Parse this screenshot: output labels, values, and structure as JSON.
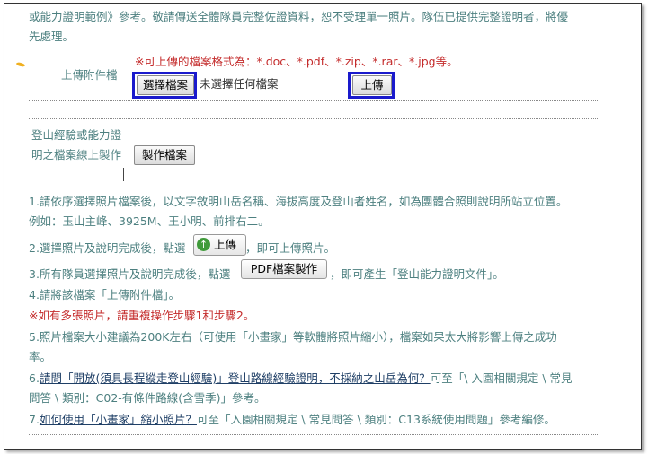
{
  "top": {
    "line1": "或能力證明範例》參考。敬請傳送全體隊員完整佐證資料，恕不受理單一照片。隊伍已提供完整證明者，將優",
    "line2": "先處理。"
  },
  "upload": {
    "label": "上傳附件檔",
    "formats_note": "※可上傳的檔案格式為：*.doc、*.pdf、*.zip、*.rar、*.jpg等。",
    "choose_button": "選擇檔案",
    "no_file": "未選擇任何檔案",
    "upload_button": "上傳"
  },
  "online": {
    "label_line1": "登山經驗或能力證",
    "label_line2": "明之檔案線上製作",
    "make_button": "製作檔案"
  },
  "steps": {
    "s1_line1": "1.請依序選擇照片檔案後，以文字敘明山岳名稱、海拔高度及登山者姓名，如為團體合照則說明所站立位置。",
    "s1_line2": "例如：玉山主峰、3925M、王小明、前排右二。",
    "s2_prefix": "2.選擇照片及說明完成後，點選",
    "s2_button": "上傳",
    "s2_suffix": "，即可上傳照片。",
    "s3_prefix": "3.所有隊員選擇照片及說明完成後，點選",
    "s3_button": "PDF檔案製作",
    "s3_suffix": "，即可產生「登山能力證明文件」。",
    "s4": "4.請將該檔案「上傳附件檔」。",
    "note_multi": "※如有多張照片，請重複操作步驟1和步驟2。",
    "s5_line1": "5.照片檔案大小建議為200K左右（可使用「小畫家」等軟體將照片縮小），檔案如果太大將影響上傳之成功",
    "s5_line2": "率。",
    "s6_prefix": "6.",
    "s6_link": "請問「開放(須具長程縱走登山經驗)」登山路線經驗證明，不採納之山岳為何？",
    "s6_suffix": "可至「\\ 入園相關規定 \\ 常見",
    "s6_line2": "問答 \\ 類別：C02-有條件路線(含雪季)」參考。",
    "s7_prefix": "7.",
    "s7_link": "如何使用「小畫家」縮小照片？",
    "s7_suffix": "可至「入園相關規定 \\ 常見問答 \\ 類別：C13系統使用問題」參考編修。"
  }
}
